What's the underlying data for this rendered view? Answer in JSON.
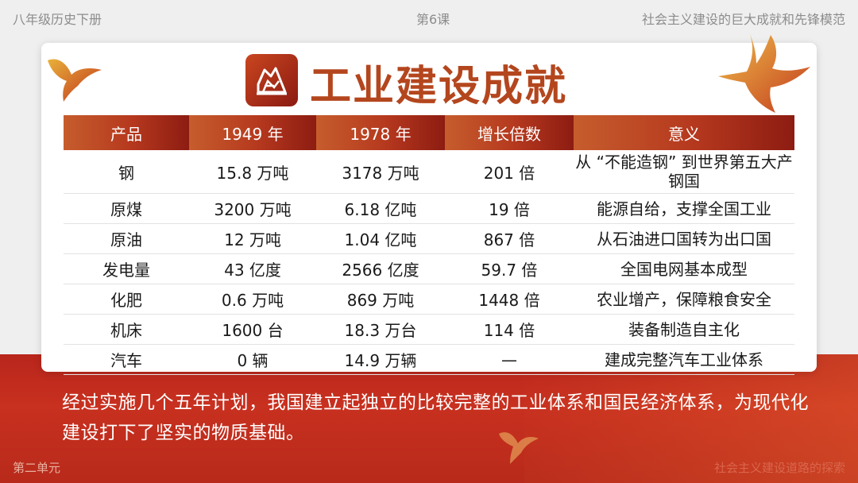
{
  "header": {
    "left": "八年级历史下册",
    "center": "第6课",
    "right": "社会主义建设的巨大成就和先锋模范"
  },
  "title": "工业建设成就",
  "table": {
    "headers": [
      "产品",
      "1949 年",
      "1978 年",
      "增长倍数",
      "意义"
    ],
    "rows": [
      {
        "product": "钢",
        "y1949": "15.8 万吨",
        "y1978": "3178 万吨",
        "growth": "201 倍",
        "meaning": "从 “不能造钢” 到世界第五大产钢国"
      },
      {
        "product": "原煤",
        "y1949": "3200 万吨",
        "y1978": "6.18 亿吨",
        "growth": "19 倍",
        "meaning": "能源自给，支撑全国工业"
      },
      {
        "product": "原油",
        "y1949": "12 万吨",
        "y1978": "1.04 亿吨",
        "growth": "867 倍",
        "meaning": "从石油进口国转为出口国"
      },
      {
        "product": "发电量",
        "y1949": "43 亿度",
        "y1978": "2566 亿度",
        "growth": "59.7 倍",
        "meaning": "全国电网基本成型"
      },
      {
        "product": "化肥",
        "y1949": "0.6 万吨",
        "y1978": "869 万吨",
        "growth": "1448 倍",
        "meaning": "农业增产，保障粮食安全"
      },
      {
        "product": "机床",
        "y1949": "1600 台",
        "y1978": "18.3 万台",
        "growth": "114 倍",
        "meaning": "装备制造自主化"
      },
      {
        "product": "汽车",
        "y1949": "0 辆",
        "y1978": "14.9 万辆",
        "growth": "—",
        "meaning": "建成完整汽车工业体系"
      }
    ]
  },
  "summary": "经过实施几个五年计划，我国建立起独立的比较完整的工业体系和国民经济体系，为现代化建设打下了坚实的物质基础。",
  "footer": {
    "left": "第二单元",
    "right": "社会主义建设道路的探索"
  },
  "colors": {
    "accent": "#b4461e",
    "banner_red": "#c8301f"
  },
  "icons": [
    "factory-icon",
    "dove-icon"
  ]
}
